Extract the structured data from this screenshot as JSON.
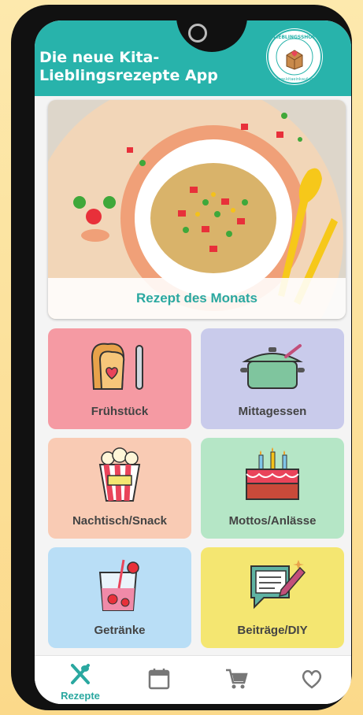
{
  "app": {
    "title": "Die neue Kita-Lieblingsrezepte App",
    "badge_text": "LIEBLINGSSHOP",
    "badge_url": "www.kitaeinkauf.de"
  },
  "hero": {
    "caption": "Rezept des Monats"
  },
  "categories": [
    {
      "label": "Frühstück",
      "icon": "toast-icon",
      "color": "#f59aa3"
    },
    {
      "label": "Mittagessen",
      "icon": "cooking-pot-icon",
      "color": "#c9cbeb"
    },
    {
      "label": "Nachtisch/Snack",
      "icon": "popcorn-icon",
      "color": "#f9cbb4"
    },
    {
      "label": "Mottos/Anlässe",
      "icon": "birthday-cake-icon",
      "color": "#b5e6c6"
    },
    {
      "label": "Getränke",
      "icon": "drink-glass-icon",
      "color": "#b9def6"
    },
    {
      "label": "Beiträge/DIY",
      "icon": "notepad-pencil-icon",
      "color": "#f4e671"
    }
  ],
  "nav": [
    {
      "label": "Rezepte",
      "icon": "cutlery-icon",
      "active": true
    },
    {
      "label": "",
      "icon": "calendar-icon",
      "active": false
    },
    {
      "label": "",
      "icon": "cart-icon",
      "active": false
    },
    {
      "label": "",
      "icon": "heart-icon",
      "active": false
    }
  ],
  "colors": {
    "accent": "#28b3ab",
    "frame": "#111111",
    "background": "#fbd98a"
  }
}
